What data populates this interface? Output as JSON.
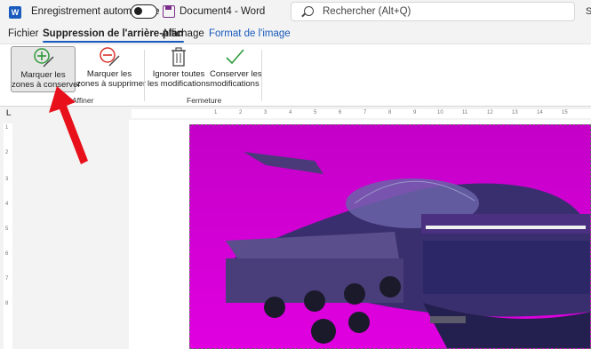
{
  "titlebar": {
    "app_logo": "W",
    "autosave_label": "Enregistrement automatique",
    "autosave_state": "off",
    "document_title": "Document4  -  Word",
    "search_placeholder": "Rechercher (Alt+Q)",
    "right_fragment": "S"
  },
  "tabs": [
    {
      "label": "Fichier"
    },
    {
      "label": "Suppression de l'arrière-plan",
      "active": true
    },
    {
      "label": "Affichage"
    },
    {
      "label": "Format de l'image",
      "contextual": true
    }
  ],
  "ribbon": {
    "groups": [
      {
        "label": "Affiner",
        "buttons": [
          {
            "line1": "Marquer les",
            "line2": "zones à conserver",
            "icon": "pencil-plus-icon",
            "selected": true
          },
          {
            "line1": "Marquer les",
            "line2": "zones à supprimer",
            "icon": "pencil-minus-icon",
            "selected": false
          }
        ]
      },
      {
        "label": "Fermeture",
        "buttons": [
          {
            "line1": "Ignorer toutes",
            "line2": "les modifications",
            "icon": "trash-icon"
          },
          {
            "line1": "Conserver les",
            "line2": "modifications",
            "icon": "checkmark-icon"
          }
        ]
      }
    ]
  },
  "ruler": {
    "corner": "L",
    "marks": [
      "1",
      "2",
      "3",
      "4",
      "5",
      "6",
      "7",
      "8",
      "9",
      "10",
      "11",
      "12",
      "13",
      "14",
      "15"
    ],
    "vertical_marks": [
      "1",
      "2",
      "3",
      "4",
      "5",
      "6",
      "7",
      "8"
    ]
  },
  "colors": {
    "accent": "#185abd",
    "background_removal_overlay": "#d800d8",
    "annotation_arrow": "#e8101a"
  }
}
